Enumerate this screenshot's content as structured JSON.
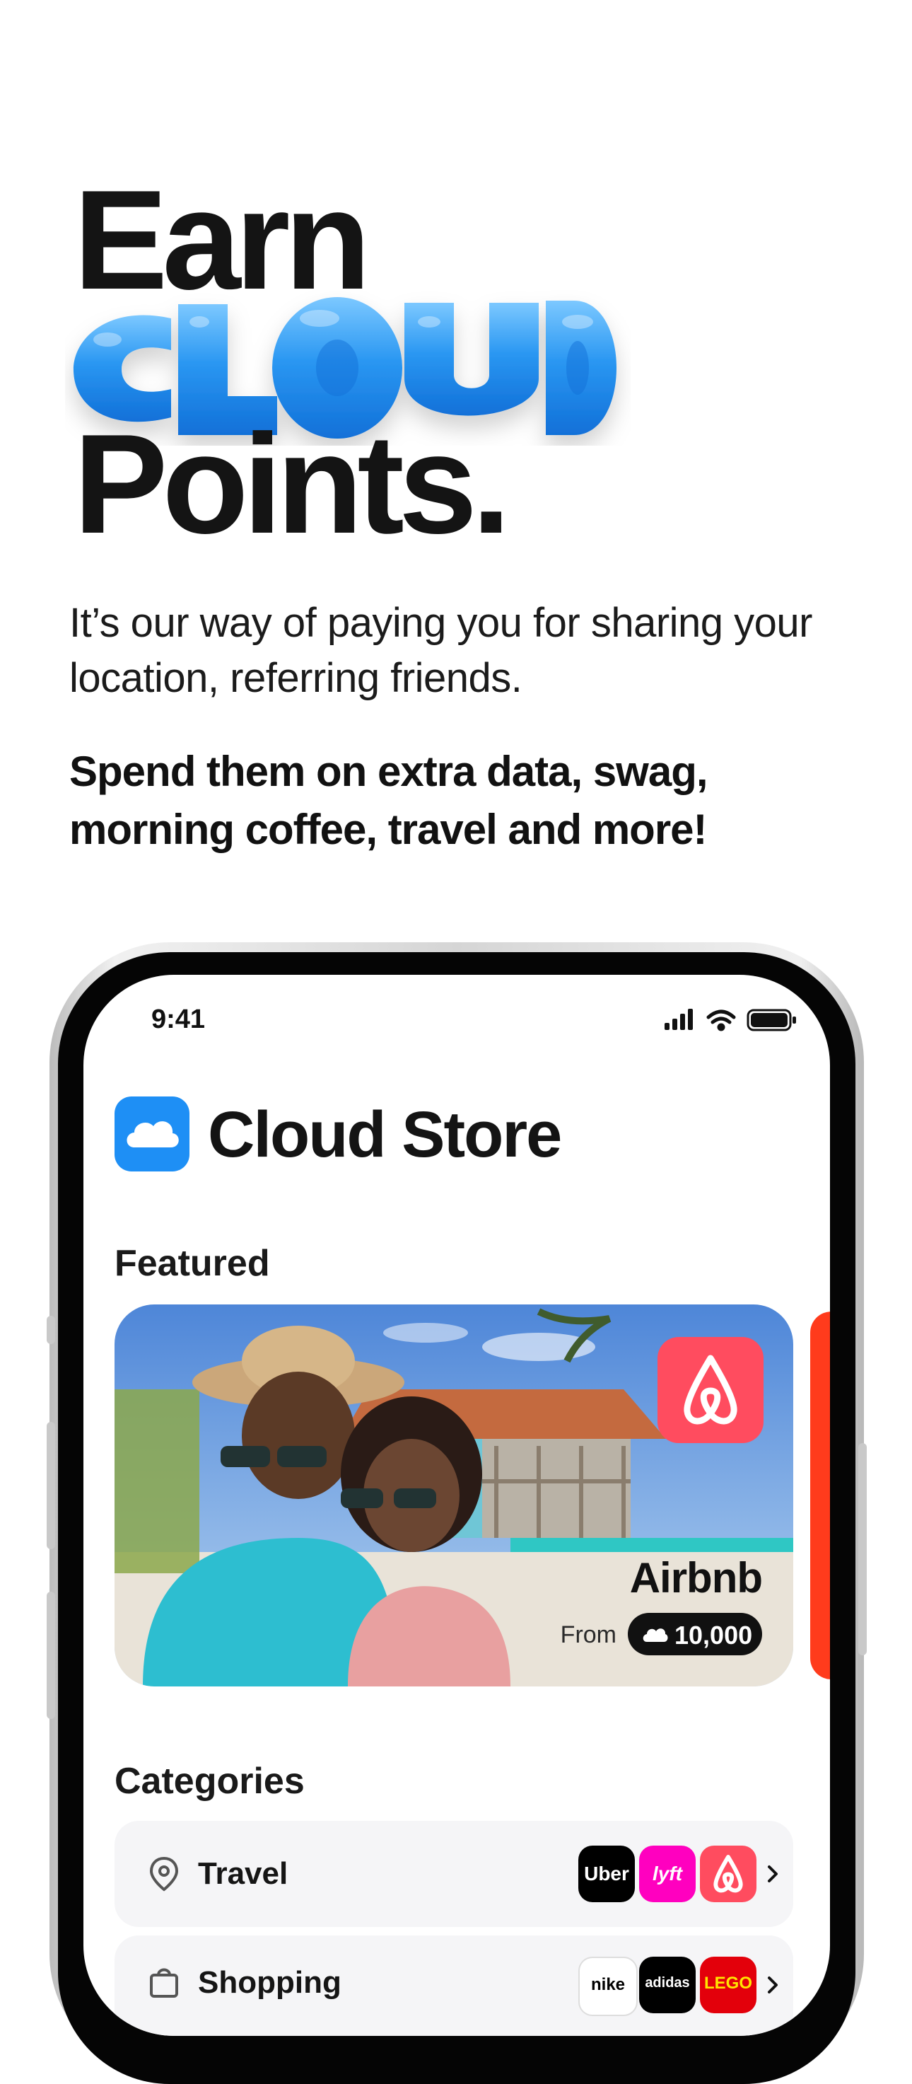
{
  "hero": {
    "line1": "Earn",
    "cloud_word": "CLOUD",
    "line2": "Points.",
    "subtitle": "It’s our way of paying you for sharing your location, referring friends.",
    "bold_text": "Spend them on extra data, swag, morning coffee, travel and more!"
  },
  "status_bar": {
    "time": "9:41",
    "icons": [
      "signal-icon",
      "wifi-icon",
      "battery-icon"
    ]
  },
  "app": {
    "title": "Cloud Store",
    "logo_icon": "cloud-icon",
    "accent": "#1e8ff5"
  },
  "featured": {
    "section_title": "Featured",
    "cards": [
      {
        "brand": "Airbnb",
        "from_label": "From",
        "points": "10,000",
        "brand_color": "#ff4c5f"
      }
    ],
    "next_card_color": "#ff3b1c"
  },
  "categories": {
    "section_title": "Categories",
    "items": [
      {
        "label": "Travel",
        "icon": "location-pin-icon",
        "brands": [
          {
            "name": "Uber",
            "bg": "#000000"
          },
          {
            "name": "lyft",
            "bg": "#ff00bf"
          },
          {
            "name": "airbnb",
            "bg": "#ff4c5f"
          }
        ]
      },
      {
        "label": "Shopping",
        "icon": "shopping-bag-icon",
        "brands": [
          {
            "name": "nike",
            "bg": "#ffffff"
          },
          {
            "name": "adidas",
            "bg": "#000000"
          },
          {
            "name": "LEGO",
            "bg": "#e3000b"
          }
        ]
      }
    ]
  }
}
